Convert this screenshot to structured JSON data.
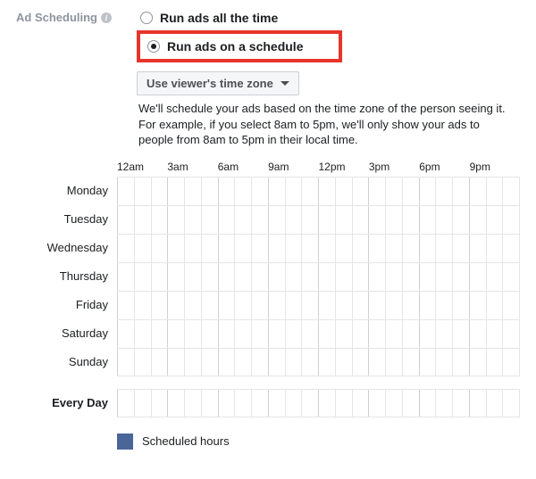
{
  "section_label": "Ad Scheduling",
  "radio_options": {
    "all_time": "Run ads all the time",
    "on_schedule": "Run ads on a schedule"
  },
  "timezone_dropdown": {
    "selected": "Use viewer's time zone"
  },
  "help": {
    "line1": "We'll schedule your ads based on the time zone of the person seeing it.",
    "line2": "For example, if you select 8am to 5pm, we'll only show your ads to people from 8am to 5pm in their local time."
  },
  "time_headers": [
    "12am",
    "3am",
    "6am",
    "9am",
    "12pm",
    "3pm",
    "6pm",
    "9pm"
  ],
  "days": [
    "Monday",
    "Tuesday",
    "Wednesday",
    "Thursday",
    "Friday",
    "Saturday",
    "Sunday"
  ],
  "every_day_label": "Every Day",
  "legend": {
    "scheduled_hours": "Scheduled hours"
  },
  "colors": {
    "highlight": "#e7352c",
    "legend_swatch": "#4a6698"
  }
}
